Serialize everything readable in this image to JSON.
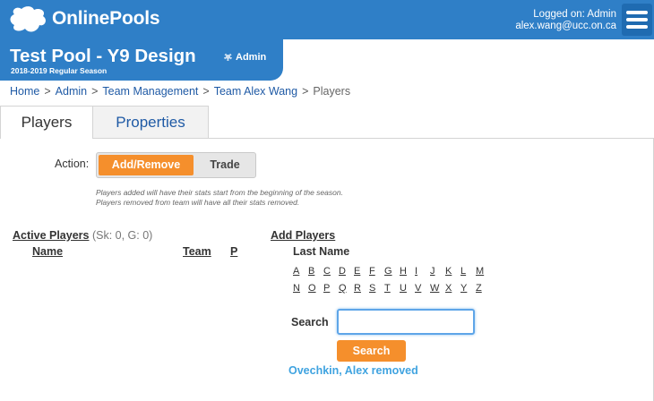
{
  "header": {
    "brand": "OnlinePools",
    "logged_on": "Logged on: Admin",
    "email": "alex.wang@ucc.on.ca",
    "colors": {
      "header_bg": "#2f7fc7",
      "accent": "#f58f2c",
      "status": "#3fa3e0"
    },
    "icons": {
      "logo": "pool-logo-icon",
      "menu": "hamburger-menu-icon",
      "admin": "gear-icon"
    }
  },
  "pool": {
    "title": "Test Pool - Y9 Design",
    "admin_label": "Admin",
    "season": "2018-2019 Regular Season"
  },
  "breadcrumb": {
    "items": [
      "Home",
      "Admin",
      "Team Management",
      "Team Alex Wang"
    ],
    "current": "Players",
    "separator": ">"
  },
  "tabs": {
    "players": "Players",
    "properties": "Properties"
  },
  "action": {
    "label": "Action:",
    "options": [
      "Add/Remove",
      "Trade"
    ],
    "selected": "Add/Remove",
    "note_line1": "Players added will have their stats start from the beginning of the season.",
    "note_line2": "Players removed from team will have all their stats removed."
  },
  "active_players": {
    "title": "Active Players",
    "counts": "(Sk: 0, G: 0)",
    "columns": {
      "name": "Name",
      "team": "Team",
      "pos": "P"
    }
  },
  "add_players": {
    "title": "Add Players",
    "last_name_label": "Last Name",
    "letters_row1": [
      "A",
      "B",
      "C",
      "D",
      "E",
      "F",
      "G",
      "H",
      "I",
      "J",
      "K",
      "L",
      "M"
    ],
    "letters_row2": [
      "N",
      "O",
      "P",
      "Q",
      "R",
      "S",
      "T",
      "U",
      "V",
      "W",
      "X",
      "Y",
      "Z"
    ],
    "search_label": "Search",
    "search_value": "",
    "search_button": "Search",
    "status_message": "Ovechkin, Alex removed"
  }
}
